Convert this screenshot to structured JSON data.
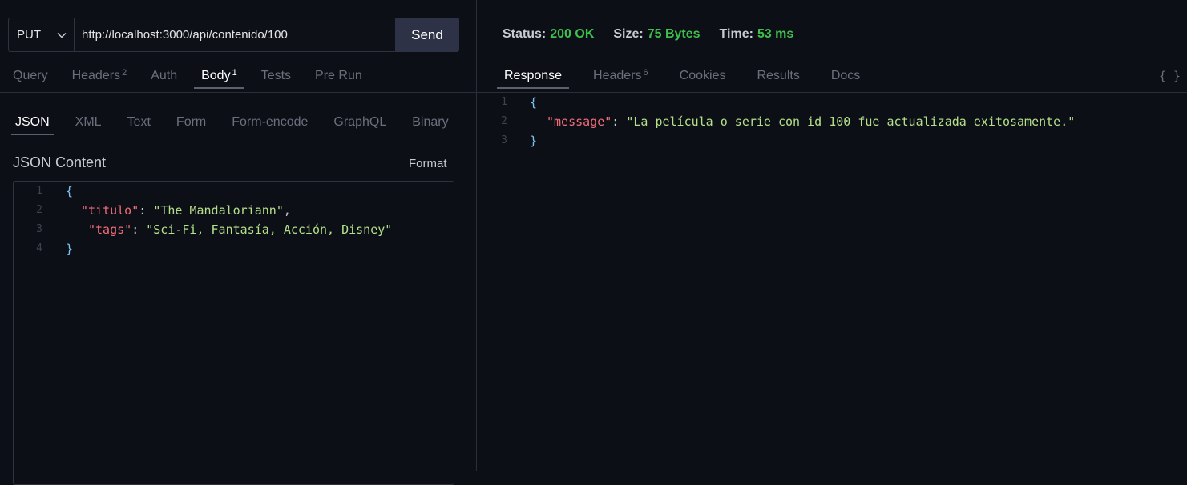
{
  "request": {
    "method": "PUT",
    "url": "http://localhost:3000/api/contenido/100",
    "send_label": "Send",
    "tabs": [
      {
        "label": "Query",
        "badge": ""
      },
      {
        "label": "Headers",
        "badge": "2"
      },
      {
        "label": "Auth",
        "badge": ""
      },
      {
        "label": "Body",
        "badge": "1"
      },
      {
        "label": "Tests",
        "badge": ""
      },
      {
        "label": "Pre Run",
        "badge": ""
      }
    ],
    "active_tab": "Body",
    "body_tabs": [
      "JSON",
      "XML",
      "Text",
      "Form",
      "Form-encode",
      "GraphQL",
      "Binary"
    ],
    "active_body_tab": "JSON",
    "content_title": "JSON Content",
    "format_label": "Format",
    "editor_lines": [
      {
        "n": "1",
        "parts": [
          {
            "t": "{",
            "c": "brace"
          }
        ]
      },
      {
        "n": "2",
        "parts": [
          {
            "t": "\"titulo\"",
            "c": "key"
          },
          {
            "t": ": ",
            "c": "punc"
          },
          {
            "t": "\"The Mandaloriann\"",
            "c": "str"
          },
          {
            "t": ",",
            "c": "punc"
          }
        ]
      },
      {
        "n": "3",
        "parts": [
          {
            "t": "\"tags\"",
            "c": "key"
          },
          {
            "t": ": ",
            "c": "punc"
          },
          {
            "t": "\"Sci-Fi, Fantasía, Acción, Disney\"",
            "c": "str"
          }
        ]
      },
      {
        "n": "4",
        "parts": [
          {
            "t": "}",
            "c": "brace"
          }
        ]
      }
    ]
  },
  "response": {
    "status_label": "Status:",
    "status_value": "200 OK",
    "size_label": "Size:",
    "size_value": "75 Bytes",
    "time_label": "Time:",
    "time_value": "53 ms",
    "tabs": [
      {
        "label": "Response",
        "badge": ""
      },
      {
        "label": "Headers",
        "badge": "6"
      },
      {
        "label": "Cookies",
        "badge": ""
      },
      {
        "label": "Results",
        "badge": ""
      },
      {
        "label": "Docs",
        "badge": ""
      }
    ],
    "active_tab": "Response",
    "braces_icon": "{ }",
    "lines": [
      {
        "n": "1",
        "parts": [
          {
            "t": "{",
            "c": "brace"
          }
        ]
      },
      {
        "n": "2",
        "parts": [
          {
            "t": "\"message\"",
            "c": "key"
          },
          {
            "t": ": ",
            "c": "punc"
          },
          {
            "t": "\"La película o serie con id 100 fue actualizada exitosamente.\"",
            "c": "str"
          }
        ]
      },
      {
        "n": "3",
        "parts": [
          {
            "t": "}",
            "c": "brace"
          }
        ]
      }
    ]
  },
  "colors": {
    "background": "#0d0f17",
    "status_ok": "#3fbf4b",
    "json_key": "#f26d78",
    "json_string": "#b4e089",
    "json_brace": "#7cc4f0"
  }
}
